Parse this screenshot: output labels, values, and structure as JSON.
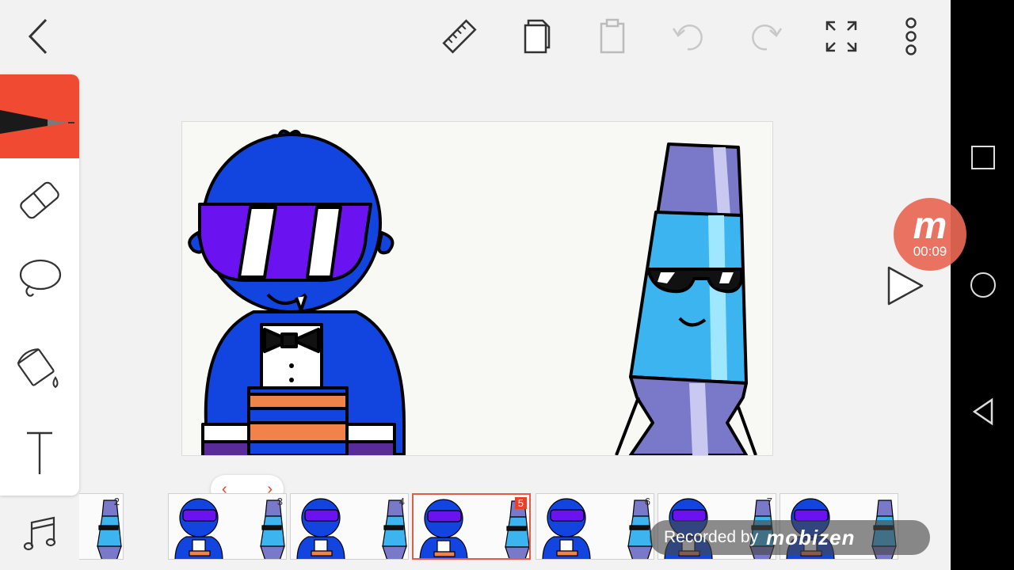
{
  "toolbar": {
    "icons": [
      "back-icon",
      "ruler-icon",
      "copy-icon",
      "paste-icon",
      "undo-icon",
      "redo-icon",
      "fullscreen-icon",
      "more-icon"
    ]
  },
  "tools": [
    "pen",
    "eraser",
    "lasso",
    "fill",
    "text",
    "music"
  ],
  "colors": {
    "accent": "#f04a33",
    "character_blue": "#1245e0",
    "glasses_purple": "#6b12f0",
    "lamp_blue": "#3cb4f0",
    "lamp_cap": "#7a78c8",
    "stripe_orange": "#f0824a"
  },
  "timeline": {
    "frames": [
      {
        "num": "2"
      },
      {
        "num": "3"
      },
      {
        "num": "4"
      },
      {
        "num": "5",
        "active": true
      },
      {
        "num": "6"
      },
      {
        "num": "7"
      },
      {
        "num": ""
      }
    ]
  },
  "recorder": {
    "logo": "m",
    "time": "00:09",
    "banner_text": "Recorded by",
    "brand": "mobizen"
  }
}
